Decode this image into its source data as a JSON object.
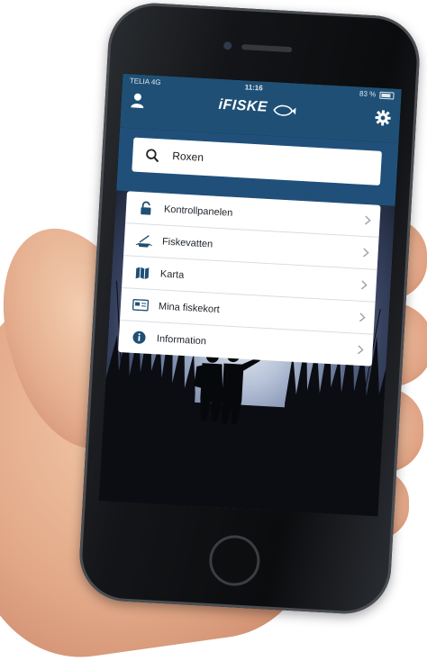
{
  "status_bar": {
    "carrier": "TELIA  4G",
    "time": "11:16",
    "battery": "83 %"
  },
  "header": {
    "logo": "iFISKE",
    "icons": [
      "user-icon",
      "gear-icon"
    ]
  },
  "search": {
    "value": "Roxen",
    "icon": "search-icon"
  },
  "menu": {
    "items": [
      {
        "label": "Kontrollpanelen",
        "icon": "lock-icon"
      },
      {
        "label": "Fiskevatten",
        "icon": "boat-icon"
      },
      {
        "label": "Karta",
        "icon": "map-icon"
      },
      {
        "label": "Mina fiskekort",
        "icon": "card-icon"
      },
      {
        "label": "Information",
        "icon": "info-icon"
      }
    ]
  },
  "colors": {
    "brand_blue": "#1f4f74",
    "menu_background": "#ffffff"
  }
}
